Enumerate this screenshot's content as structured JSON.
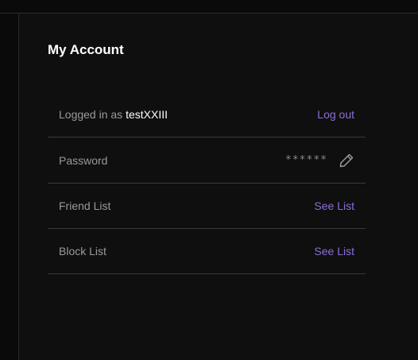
{
  "page": {
    "title": "My Account"
  },
  "account": {
    "logged_in_prefix": "Logged in as ",
    "username": "testXXIII",
    "logout_label": "Log out"
  },
  "password": {
    "label": "Password",
    "masked_value": "******",
    "edit_icon": "pencil-icon"
  },
  "friend_list": {
    "label": "Friend List",
    "link_label": "See List"
  },
  "block_list": {
    "label": "Block List",
    "link_label": "See List"
  },
  "colors": {
    "background": "#0f0f0f",
    "text_primary": "#ffffff",
    "text_secondary": "#9a9a9a",
    "accent_link": "#8b6fd6",
    "divider": "#3a3a3a"
  }
}
